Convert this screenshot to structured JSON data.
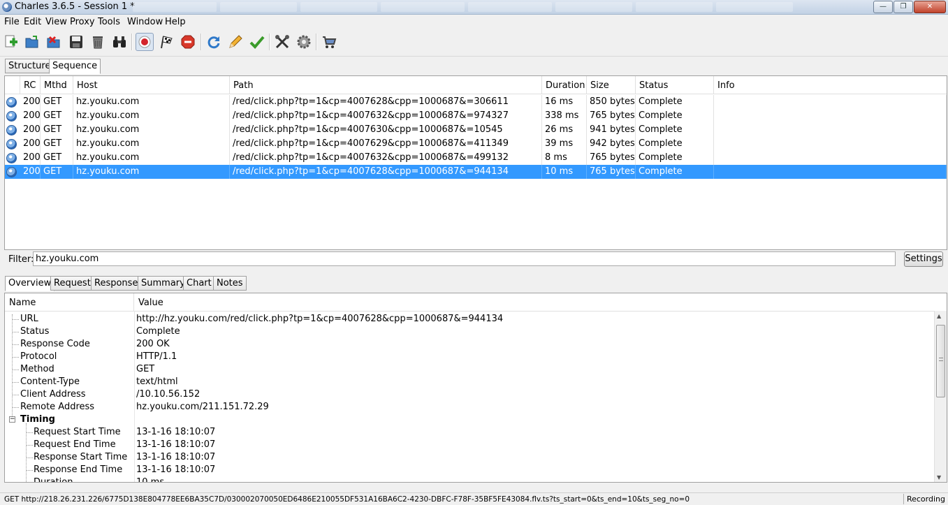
{
  "window": {
    "title": "Charles 3.6.5 - Session 1 *",
    "minimize_glyph": "—",
    "maximize_glyph": "❐",
    "close_glyph": "✕"
  },
  "menu": [
    "File",
    "Edit",
    "View",
    "Proxy",
    "Tools",
    "Window",
    "Help"
  ],
  "toolbar": {
    "icons": [
      "new-session-icon",
      "open-icon",
      "close-session-icon",
      "save-icon",
      "trash-icon",
      "binoculars-icon",
      "record-icon",
      "throttle-flag-icon",
      "stop-icon",
      "refresh-icon",
      "edit-pencil-icon",
      "validate-check-icon",
      "tools-icon",
      "settings-gear-icon",
      "shopping-cart-icon"
    ]
  },
  "top_tabs": [
    "Structure",
    "Sequence"
  ],
  "sequence_table": {
    "columns": [
      "RC",
      "Mthd",
      "Host",
      "Path",
      "Duration",
      "Size",
      "Status",
      "Info"
    ],
    "rows": [
      {
        "rc": "200",
        "method": "GET",
        "host": "hz.youku.com",
        "path": "/red/click.php?tp=1&cp=4007628&cpp=1000687&=306611",
        "duration": "16 ms",
        "size": "850 bytes",
        "status": "Complete",
        "info": ""
      },
      {
        "rc": "200",
        "method": "GET",
        "host": "hz.youku.com",
        "path": "/red/click.php?tp=1&cp=4007632&cpp=1000687&=974327",
        "duration": "338 ms",
        "size": "765 bytes",
        "status": "Complete",
        "info": ""
      },
      {
        "rc": "200",
        "method": "GET",
        "host": "hz.youku.com",
        "path": "/red/click.php?tp=1&cp=4007630&cpp=1000687&=10545",
        "duration": "26 ms",
        "size": "941 bytes",
        "status": "Complete",
        "info": ""
      },
      {
        "rc": "200",
        "method": "GET",
        "host": "hz.youku.com",
        "path": "/red/click.php?tp=1&cp=4007629&cpp=1000687&=411349",
        "duration": "39 ms",
        "size": "942 bytes",
        "status": "Complete",
        "info": ""
      },
      {
        "rc": "200",
        "method": "GET",
        "host": "hz.youku.com",
        "path": "/red/click.php?tp=1&cp=4007632&cpp=1000687&=499132",
        "duration": "8 ms",
        "size": "765 bytes",
        "status": "Complete",
        "info": ""
      },
      {
        "rc": "200",
        "method": "GET",
        "host": "hz.youku.com",
        "path": "/red/click.php?tp=1&cp=4007628&cpp=1000687&=944134",
        "duration": "10 ms",
        "size": "765 bytes",
        "status": "Complete",
        "info": ""
      }
    ],
    "selected_index": 5
  },
  "filter": {
    "label": "Filter:",
    "value": "hz.youku.com",
    "settings_label": "Settings"
  },
  "detail_tabs": [
    "Overview",
    "Request",
    "Response",
    "Summary",
    "Chart",
    "Notes"
  ],
  "overview": {
    "columns": [
      "Name",
      "Value"
    ],
    "rows": [
      {
        "name": "URL",
        "value": "http://hz.youku.com/red/click.php?tp=1&cp=4007628&cpp=1000687&=944134"
      },
      {
        "name": "Status",
        "value": "Complete"
      },
      {
        "name": "Response Code",
        "value": "200 OK"
      },
      {
        "name": "Protocol",
        "value": "HTTP/1.1"
      },
      {
        "name": "Method",
        "value": "GET"
      },
      {
        "name": "Content-Type",
        "value": "text/html"
      },
      {
        "name": "Client Address",
        "value": "/10.10.56.152"
      },
      {
        "name": "Remote Address",
        "value": "hz.youku.com/211.151.72.29"
      }
    ],
    "timing_label": "Timing",
    "timing_expander": "−",
    "timing_rows": [
      {
        "name": "Request Start Time",
        "value": "13-1-16 18:10:07"
      },
      {
        "name": "Request End Time",
        "value": "13-1-16 18:10:07"
      },
      {
        "name": "Response Start Time",
        "value": "13-1-16 18:10:07"
      },
      {
        "name": "Response End Time",
        "value": "13-1-16 18:10:07"
      },
      {
        "name": "Duration",
        "value": "10 ms"
      }
    ]
  },
  "statusbar": {
    "text": "GET http://218.26.231.226/6775D138E804778EE6BA35C7D/030002070050ED6486E210055DF531A16BA6C2-4230-DBFC-F78F-35BF5FE43084.flv.ts?ts_start=0&ts_end=10&ts_seg_no=0",
    "recording": "Recording"
  }
}
